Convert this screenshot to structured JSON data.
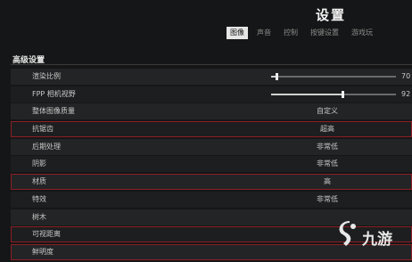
{
  "header": {
    "title": "设置",
    "tabs": [
      {
        "label": "图像",
        "active": true
      },
      {
        "label": "声音",
        "active": false
      },
      {
        "label": "控制",
        "active": false
      },
      {
        "label": "按键设置",
        "active": false
      },
      {
        "label": "游戏玩",
        "active": false
      }
    ]
  },
  "section": {
    "title": "高级设置"
  },
  "rows": [
    {
      "label": "渲染比例",
      "type": "slider",
      "value_text": "70",
      "fraction": 0.04
    },
    {
      "label": "FPP 相机视野",
      "type": "slider",
      "value_text": "92",
      "fraction": 0.57
    },
    {
      "label": "整体图像质量",
      "type": "value",
      "value_text": "自定义"
    },
    {
      "label": "抗锯齿",
      "type": "value",
      "value_text": "超高",
      "highlighted": true
    },
    {
      "label": "后期处理",
      "type": "value",
      "value_text": "非常低"
    },
    {
      "label": "阴影",
      "type": "value",
      "value_text": "非常低"
    },
    {
      "label": "材质",
      "type": "value",
      "value_text": "高",
      "highlighted": true
    },
    {
      "label": "特效",
      "type": "value",
      "value_text": "非常低"
    },
    {
      "label": "树木",
      "type": "value",
      "value_text": ""
    },
    {
      "label": "可视距离",
      "type": "value",
      "value_text": "",
      "highlighted": true
    },
    {
      "label": "鲜明度",
      "type": "value",
      "value_text": "",
      "highlighted": true
    }
  ],
  "watermark": {
    "text": "九游",
    "logo_icon": "jiuyou-logo-icon"
  },
  "colors": {
    "background": "#151617",
    "row": "#232425",
    "highlight": "#8c1f25"
  }
}
